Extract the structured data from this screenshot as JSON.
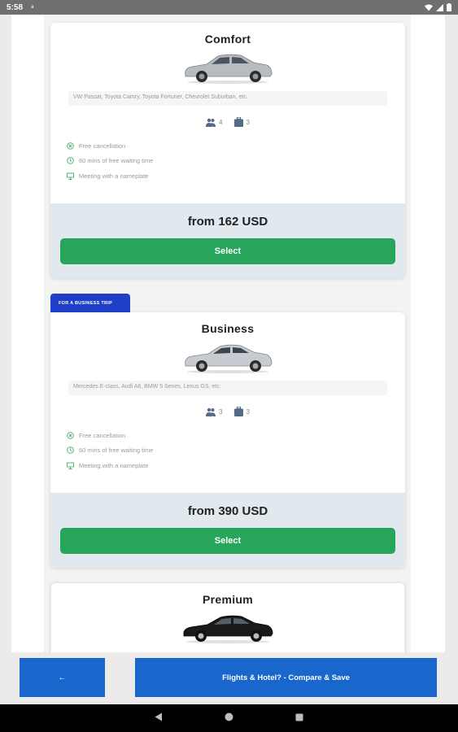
{
  "status_bar": {
    "time": "5:58",
    "notification_icon": "a-icon"
  },
  "cards": [
    {
      "title": "Comfort",
      "models": "VW Passat, Toyota Camry, Toyota Fortuner, Chevrolet Suburban, etc.",
      "passengers": "4",
      "luggage": "3",
      "features": [
        "Free cancellation",
        "60 mins of free waiting time",
        "Meeting with a nameplate"
      ],
      "price": "from 162 USD",
      "select_label": "Select",
      "car_color": "#b8bcc0"
    },
    {
      "badge": "FOR A BUSINESS TRIP",
      "title": "Business",
      "models": "Mercedes E-class, Audi A6, BMW 5 Series, Lexus GS, etc.",
      "passengers": "3",
      "luggage": "3",
      "features": [
        "Free cancellation",
        "60 mins of free waiting time",
        "Meeting with a nameplate"
      ],
      "price": "from 390 USD",
      "select_label": "Select",
      "car_color": "#c8ccd0"
    },
    {
      "title": "Premium",
      "car_color": "#1a1a1a"
    }
  ],
  "bottom": {
    "back_label": "←",
    "promo_label": "Flights & Hotel? - Compare & Save"
  },
  "colors": {
    "select": "#27a55a",
    "primary": "#1966cc",
    "badge": "#1f3fc8",
    "price_panel": "#e1e8ee"
  }
}
